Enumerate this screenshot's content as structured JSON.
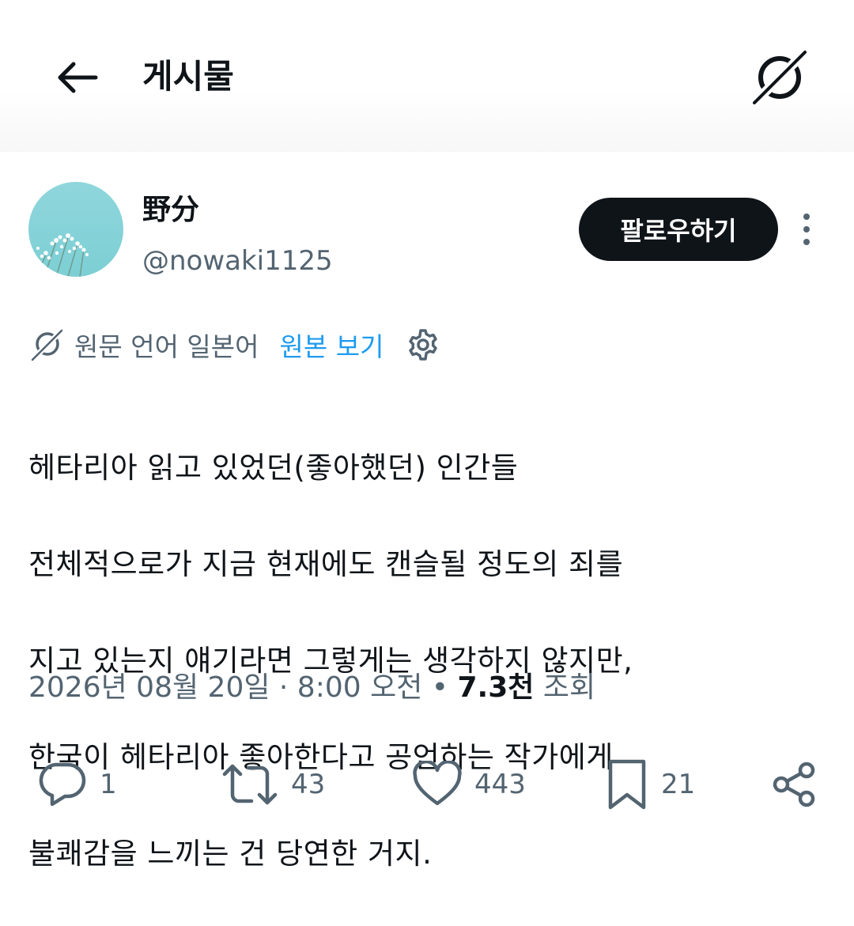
{
  "header": {
    "title": "게시물",
    "back_icon": "arrow-left-icon",
    "translate_icon": "translate-off-icon"
  },
  "author": {
    "display_name": "野分",
    "handle": "@nowaki1125",
    "follow_label": "팔로우하기",
    "more_icon": "more-vertical-icon"
  },
  "translation": {
    "status": "원문 언어 일본어",
    "show_original": "원본 보기",
    "settings_icon": "gear-icon"
  },
  "post": {
    "lines": [
      "헤타리아 읽고 있었던(좋아했던) 인간들",
      "전체적으로가 지금 현재에도 캔슬될 정도의 죄를",
      "지고 있는지 얘기라면 그렇게는 생각하지 않지만,",
      "한국이 헤타리아 좋아한다고 공언하는 작가에게",
      "불쾌감을 느끼는 건 당연한 거지."
    ]
  },
  "meta": {
    "datetime": "2026년 08월 20일 · 8:00 오전",
    "separator": " • ",
    "views_count": "7.3천",
    "views_label": " 조회"
  },
  "actions": {
    "reply_count": "1",
    "repost_count": "43",
    "like_count": "443",
    "bookmark_count": "21"
  },
  "colors": {
    "text": "#0f1419",
    "secondary": "#536471",
    "link": "#1d9bf0",
    "button_bg": "#0f1419"
  }
}
